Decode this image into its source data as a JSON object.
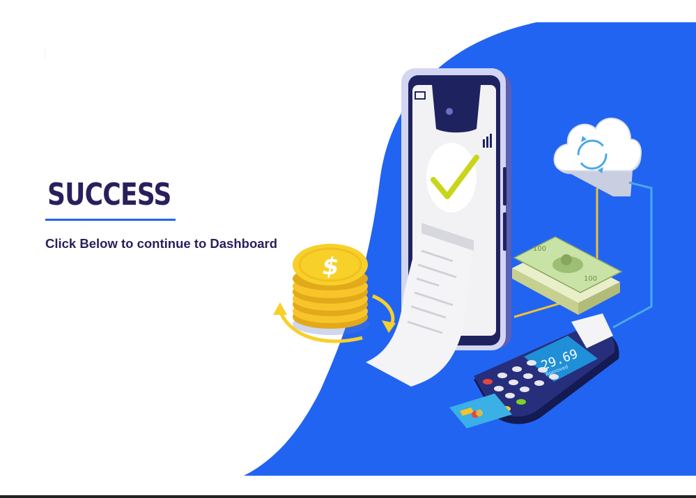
{
  "success": {
    "title": "SUCCESS",
    "subtitle": "Click Below to continue to Dashboard"
  },
  "illustration": {
    "terminal_amount": "29.69",
    "terminal_status": "Approved",
    "banknote_value": "100"
  },
  "colors": {
    "title": "#2a1f5c",
    "accent": "#2264f2",
    "background_wave": "#2264f2"
  }
}
